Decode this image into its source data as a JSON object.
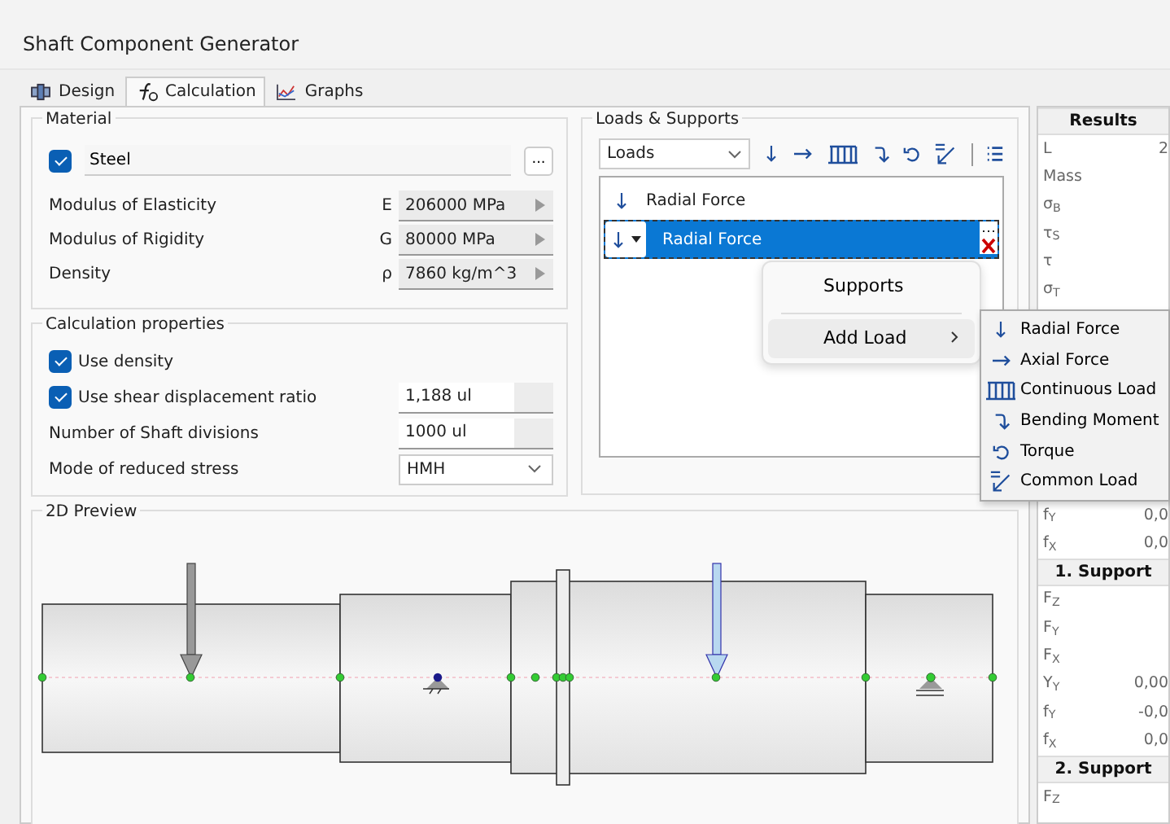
{
  "window": {
    "title": "Shaft Component Generator"
  },
  "tabs": [
    {
      "label": "Design",
      "selected": false
    },
    {
      "label": "Calculation",
      "selected": true
    },
    {
      "label": "Graphs",
      "selected": false
    }
  ],
  "material": {
    "title": "Material",
    "checked": true,
    "name": "Steel",
    "browse": "...",
    "properties": [
      {
        "label": "Modulus of Elasticity",
        "symbol": "E",
        "value": "206000 MPa"
      },
      {
        "label": "Modulus of Rigidity",
        "symbol": "G",
        "value": "80000 MPa"
      },
      {
        "label": "Density",
        "symbol": "ρ",
        "value": "7860 kg/m^3"
      }
    ]
  },
  "calculation_properties": {
    "title": "Calculation properties",
    "items": [
      {
        "kind": "checkbox",
        "label": "Use density",
        "checked": true
      },
      {
        "kind": "checkbox",
        "label": "Use shear displacement ratio",
        "checked": true,
        "value": "1,188 ul"
      },
      {
        "kind": "input",
        "label": "Number of Shaft divisions",
        "value": "1000 ul"
      },
      {
        "kind": "select",
        "label": "Mode of reduced stress",
        "value": "HMH"
      }
    ]
  },
  "loads_supports": {
    "title": "Loads & Supports",
    "filter": "Loads",
    "items": [
      {
        "label": "Radial Force",
        "kind": "radial",
        "selected": false
      },
      {
        "label": "Radial Force",
        "kind": "radial",
        "selected": true
      }
    ]
  },
  "preview": {
    "title": "2D Preview"
  },
  "results": {
    "title": "Results",
    "rows": [
      {
        "kind": "row",
        "label": "L",
        "value": "2"
      },
      {
        "kind": "row",
        "label": "Mass"
      },
      {
        "kind": "row",
        "label": "σ$_{B}$"
      },
      {
        "kind": "row",
        "label": "τ$_{S}$"
      },
      {
        "kind": "row",
        "label": "τ"
      },
      {
        "kind": "row",
        "label": "σ$_{T}$"
      },
      {
        "kind": "gap"
      },
      {
        "kind": "row",
        "label": "f$_{Y}$",
        "value": "0,0"
      },
      {
        "kind": "row",
        "label": "f$_{X}$",
        "value": "0,0"
      },
      {
        "kind": "header",
        "label": "1. Support"
      },
      {
        "kind": "row",
        "label": "F$_{Z}$"
      },
      {
        "kind": "row",
        "label": "F$_{Y}$"
      },
      {
        "kind": "row",
        "label": "F$_{X}$"
      },
      {
        "kind": "row",
        "label": "Y$_{Y}$",
        "value": "0,00"
      },
      {
        "kind": "row",
        "label": "f$_{Y}$",
        "value": "-0,0"
      },
      {
        "kind": "row",
        "label": "f$_{X}$",
        "value": "0,0"
      },
      {
        "kind": "header",
        "label": "2. Support"
      },
      {
        "kind": "row",
        "label": "F$_{Z}$"
      }
    ]
  },
  "context_menu": {
    "items": [
      {
        "label": "Supports",
        "selected": false,
        "submenu": false
      },
      {
        "label": "Add Load",
        "selected": true,
        "submenu": true
      }
    ]
  },
  "submenu": {
    "items": [
      {
        "label": "Radial Force",
        "kind": "radial"
      },
      {
        "label": "Axial Force",
        "kind": "axial"
      },
      {
        "label": "Continuous Load",
        "kind": "continuous"
      },
      {
        "label": "Bending Moment",
        "kind": "bending"
      },
      {
        "label": "Torque",
        "kind": "torque"
      },
      {
        "label": "Common Load",
        "kind": "common"
      }
    ]
  }
}
